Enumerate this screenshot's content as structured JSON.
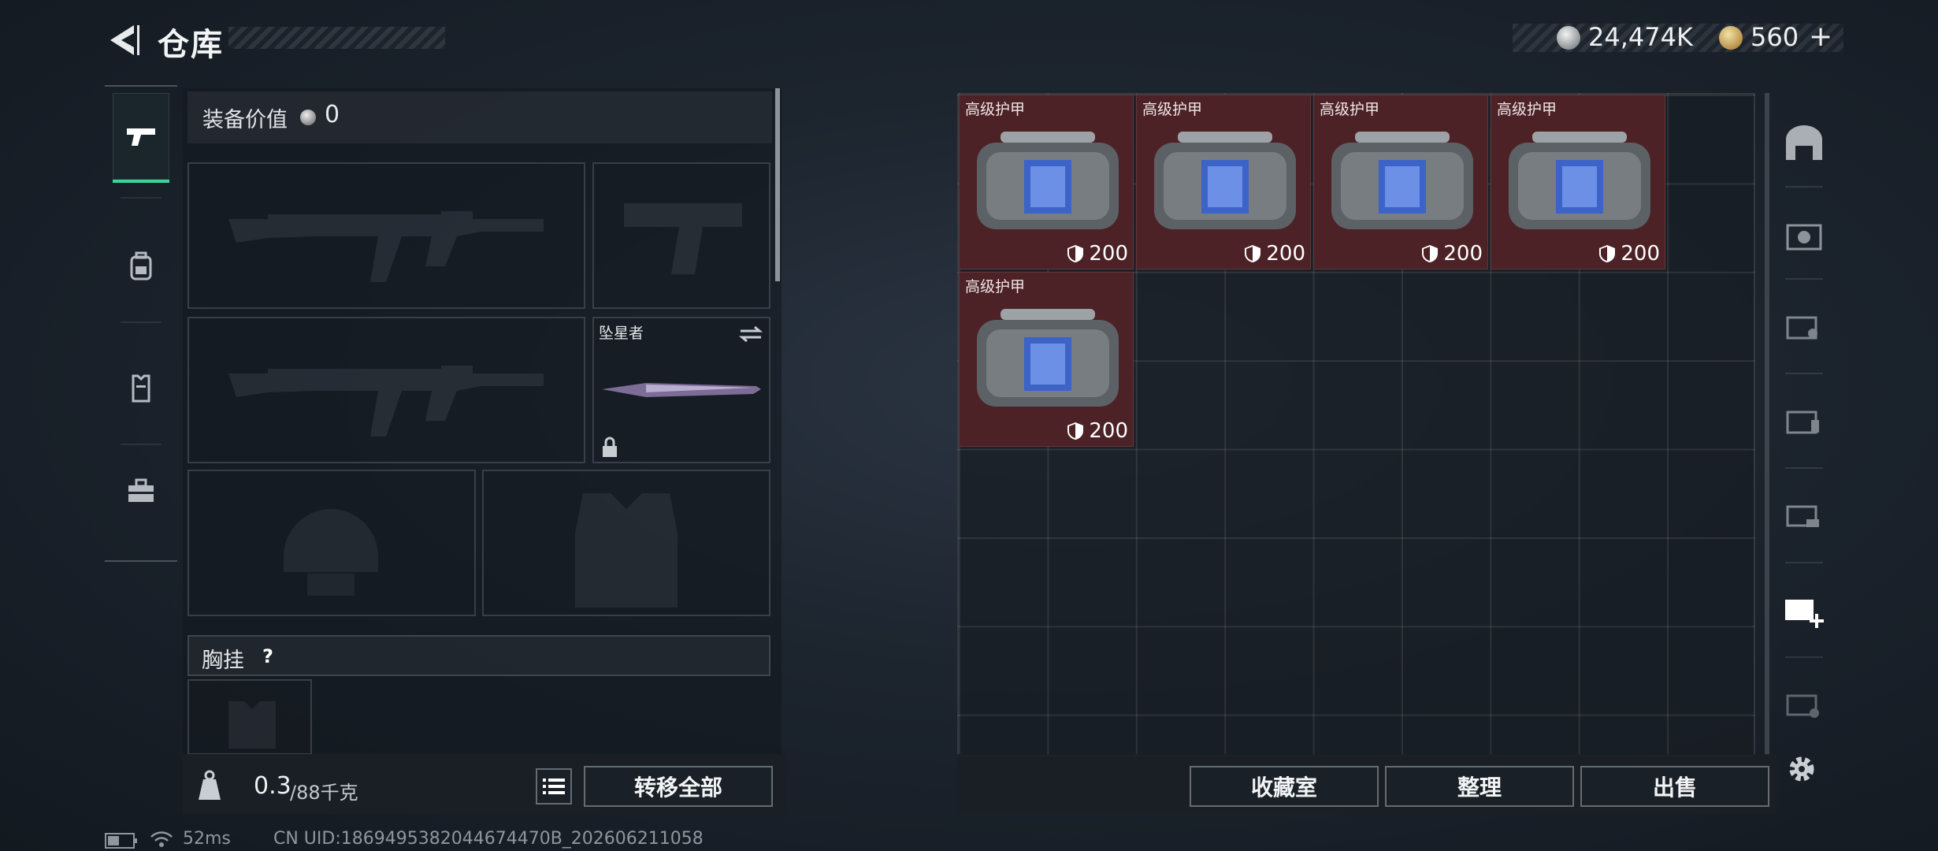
{
  "header": {
    "title": "仓库",
    "silver_amount": "24,474K",
    "gold_amount": "560",
    "add_symbol": "+"
  },
  "equipment": {
    "value_label": "装备价值",
    "value": "0",
    "melee_name": "坠星者",
    "chest_rig_label": "胸挂",
    "help_symbol": "?"
  },
  "weight": {
    "current": "0.3",
    "max": "/88千克"
  },
  "buttons": {
    "transfer_all": "转移全部",
    "collection": "收藏室",
    "organize": "整理",
    "sell": "出售"
  },
  "items": [
    {
      "name": "高级护甲",
      "value": "200"
    },
    {
      "name": "高级护甲",
      "value": "200"
    },
    {
      "name": "高级护甲",
      "value": "200"
    },
    {
      "name": "高级护甲",
      "value": "200"
    },
    {
      "name": "高级护甲",
      "value": "200"
    }
  ],
  "status": {
    "ping": "52ms",
    "uid": "CN UID:1869495382044674470B_202606211058"
  },
  "colors": {
    "accent": "#3fd29a",
    "item_bg": "#4c2226"
  }
}
